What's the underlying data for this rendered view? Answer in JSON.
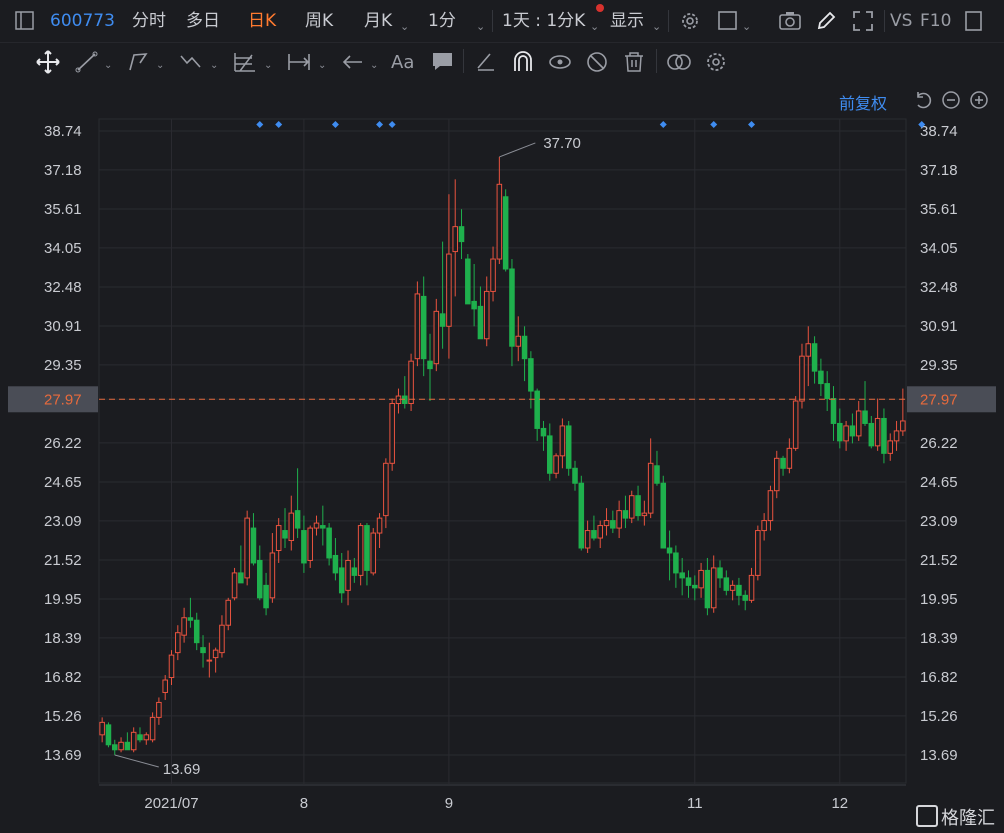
{
  "topbar": {
    "code": "600773",
    "tabs": [
      "分时",
      "多日",
      "日K",
      "周K",
      "月K",
      "1分"
    ],
    "active_tab": "日K",
    "period_select": "1天 : 1分K",
    "display_label": "显示",
    "vs_label": "VS",
    "f10_label": "F10"
  },
  "toolbar": {
    "icons": [
      "move-icon",
      "line-draw-icon",
      "polyline-icon",
      "wave-icon",
      "fib-grid-icon",
      "range-icon",
      "arrow-left-icon",
      "text-icon",
      "comment-icon",
      "eraser-icon",
      "magnet-icon",
      "eye-icon",
      "hide-icon",
      "trash-icon",
      "overlay-icon",
      "settings-icon"
    ],
    "text_glyph": "Aa"
  },
  "chart_ctrl": {
    "adjust_label": "前复权",
    "undo_icon": "undo-icon",
    "zoom_out_icon": "zoom-out-icon",
    "zoom_in_icon": "zoom-in-icon"
  },
  "watermark": "格隆汇",
  "chart_data": {
    "type": "candlestick",
    "y_ticks": [
      "38.74",
      "37.18",
      "35.61",
      "34.05",
      "32.48",
      "30.91",
      "29.35",
      "27.97",
      "26.22",
      "24.65",
      "23.09",
      "21.52",
      "19.95",
      "18.39",
      "16.82",
      "15.26",
      "13.69"
    ],
    "x_tick_labels": [
      {
        "label": "2021/07",
        "bar": 11
      },
      {
        "label": "8",
        "bar": 32
      },
      {
        "label": "9",
        "bar": 55
      },
      {
        "label": "11",
        "bar": 94
      },
      {
        "label": "12",
        "bar": 117
      }
    ],
    "ylim": [
      13.69,
      38.74
    ],
    "current_price": 27.97,
    "max_annotation": {
      "value": 37.7,
      "label": "37.70",
      "bar": 63
    },
    "min_annotation": {
      "value": 13.69,
      "label": "13.69",
      "bar": 2
    },
    "event_markers": [
      25,
      28,
      37,
      44,
      46,
      89,
      97,
      103,
      130
    ],
    "colors": {
      "up": "#e9533f",
      "down": "#1fb04d",
      "price_line": "#e86a3c",
      "price_tag_bg": "#4a4d56",
      "marker": "#3f8cf0"
    },
    "candles": [
      [
        14.5,
        15.2,
        14.2,
        15.0
      ],
      [
        14.9,
        15.0,
        14.0,
        14.1
      ],
      [
        14.1,
        14.3,
        13.69,
        13.9
      ],
      [
        13.9,
        14.4,
        13.8,
        14.2
      ],
      [
        14.2,
        14.6,
        13.9,
        13.9
      ],
      [
        13.9,
        14.8,
        13.8,
        14.6
      ],
      [
        14.5,
        14.8,
        14.2,
        14.3
      ],
      [
        14.3,
        14.6,
        14.1,
        14.5
      ],
      [
        14.3,
        15.4,
        14.2,
        15.2
      ],
      [
        15.2,
        16.0,
        14.9,
        15.8
      ],
      [
        16.2,
        16.9,
        15.9,
        16.7
      ],
      [
        16.8,
        17.9,
        16.5,
        17.7
      ],
      [
        17.8,
        18.9,
        17.5,
        18.6
      ],
      [
        18.5,
        19.6,
        18.2,
        19.2
      ],
      [
        19.2,
        20.0,
        18.8,
        19.1
      ],
      [
        19.1,
        19.4,
        17.9,
        18.2
      ],
      [
        18.0,
        18.5,
        17.2,
        17.8
      ],
      [
        17.5,
        18.2,
        16.8,
        17.5
      ],
      [
        17.6,
        18.0,
        17.0,
        17.9
      ],
      [
        17.8,
        19.3,
        17.6,
        18.9
      ],
      [
        18.9,
        20.0,
        18.7,
        19.9
      ],
      [
        20.0,
        21.2,
        19.9,
        21.0
      ],
      [
        21.0,
        22.1,
        20.7,
        20.6
      ],
      [
        20.8,
        23.5,
        20.5,
        23.2
      ],
      [
        22.8,
        23.4,
        21.3,
        21.4
      ],
      [
        21.5,
        22.1,
        19.9,
        20.0
      ],
      [
        20.5,
        21.0,
        19.3,
        19.6
      ],
      [
        20.0,
        22.6,
        19.8,
        21.8
      ],
      [
        21.9,
        23.2,
        21.4,
        22.9
      ],
      [
        22.7,
        23.6,
        22.0,
        22.4
      ],
      [
        22.3,
        24.1,
        21.9,
        23.4
      ],
      [
        23.5,
        25.2,
        22.4,
        22.8
      ],
      [
        22.7,
        23.3,
        21.0,
        21.4
      ],
      [
        21.5,
        22.9,
        21.2,
        22.8
      ],
      [
        22.8,
        23.3,
        22.5,
        23.0
      ],
      [
        22.9,
        23.7,
        22.1,
        22.8
      ],
      [
        22.8,
        23.0,
        21.3,
        21.6
      ],
      [
        21.7,
        22.4,
        20.7,
        21.0
      ],
      [
        21.2,
        21.8,
        19.8,
        20.2
      ],
      [
        20.3,
        21.9,
        19.7,
        21.5
      ],
      [
        21.2,
        21.6,
        20.6,
        20.9
      ],
      [
        20.9,
        23.0,
        20.5,
        22.9
      ],
      [
        22.9,
        23.0,
        20.5,
        21.1
      ],
      [
        21.0,
        22.8,
        20.9,
        22.6
      ],
      [
        22.6,
        23.4,
        22.0,
        23.2
      ],
      [
        23.3,
        25.6,
        22.8,
        25.4
      ],
      [
        25.4,
        28.0,
        25.1,
        27.8
      ],
      [
        27.8,
        28.4,
        27.4,
        28.1
      ],
      [
        28.1,
        28.9,
        27.6,
        27.8
      ],
      [
        27.8,
        29.8,
        27.5,
        29.5
      ],
      [
        29.6,
        32.7,
        29.3,
        32.2
      ],
      [
        32.1,
        32.9,
        28.9,
        29.6
      ],
      [
        29.5,
        30.6,
        27.9,
        29.2
      ],
      [
        29.4,
        32.0,
        29.1,
        31.5
      ],
      [
        31.4,
        34.3,
        30.0,
        30.9
      ],
      [
        30.9,
        36.2,
        29.6,
        33.8
      ],
      [
        33.9,
        36.8,
        32.1,
        34.9
      ],
      [
        34.9,
        35.6,
        33.6,
        34.3
      ],
      [
        33.6,
        33.8,
        31.9,
        31.8
      ],
      [
        31.9,
        33.4,
        30.9,
        31.6
      ],
      [
        31.7,
        32.5,
        30.4,
        30.4
      ],
      [
        30.4,
        32.9,
        30.1,
        32.3
      ],
      [
        32.3,
        34.1,
        31.9,
        33.6
      ],
      [
        33.6,
        37.7,
        33.4,
        36.6
      ],
      [
        36.1,
        36.4,
        33.1,
        33.2
      ],
      [
        33.2,
        33.6,
        29.3,
        30.1
      ],
      [
        30.1,
        31.3,
        29.5,
        30.5
      ],
      [
        30.5,
        30.9,
        28.7,
        29.6
      ],
      [
        29.6,
        29.9,
        27.6,
        28.3
      ],
      [
        28.3,
        28.4,
        26.3,
        26.8
      ],
      [
        26.8,
        27.1,
        25.9,
        26.5
      ],
      [
        26.5,
        27.0,
        24.7,
        25.0
      ],
      [
        25.0,
        25.8,
        24.8,
        25.7
      ],
      [
        25.7,
        27.2,
        25.2,
        26.9
      ],
      [
        26.9,
        27.1,
        24.9,
        25.2
      ],
      [
        25.2,
        25.5,
        24.3,
        24.6
      ],
      [
        24.6,
        24.9,
        21.9,
        22.0
      ],
      [
        22.0,
        23.1,
        21.8,
        22.7
      ],
      [
        22.7,
        23.3,
        22.3,
        22.4
      ],
      [
        22.4,
        23.1,
        22.0,
        22.9
      ],
      [
        22.9,
        23.6,
        22.5,
        23.1
      ],
      [
        23.1,
        23.5,
        22.6,
        22.8
      ],
      [
        22.8,
        23.9,
        22.4,
        23.5
      ],
      [
        23.5,
        24.1,
        22.8,
        23.2
      ],
      [
        23.2,
        24.3,
        23.0,
        24.1
      ],
      [
        24.1,
        24.5,
        23.1,
        23.3
      ],
      [
        23.3,
        23.9,
        22.9,
        23.4
      ],
      [
        23.4,
        26.4,
        23.2,
        25.4
      ],
      [
        25.3,
        25.9,
        24.5,
        24.6
      ],
      [
        24.6,
        24.9,
        22.1,
        22.0
      ],
      [
        22.0,
        22.7,
        20.7,
        21.8
      ],
      [
        21.8,
        22.1,
        20.4,
        21.0
      ],
      [
        21.0,
        21.6,
        20.1,
        20.8
      ],
      [
        20.8,
        21.1,
        20.0,
        20.5
      ],
      [
        20.5,
        20.9,
        19.9,
        20.4
      ],
      [
        20.4,
        21.4,
        20.0,
        21.1
      ],
      [
        21.1,
        21.6,
        19.3,
        19.6
      ],
      [
        19.6,
        21.7,
        19.4,
        21.2
      ],
      [
        21.2,
        21.5,
        20.4,
        20.8
      ],
      [
        20.8,
        21.1,
        20.1,
        20.3
      ],
      [
        20.3,
        20.7,
        19.9,
        20.5
      ],
      [
        20.5,
        20.8,
        19.7,
        20.1
      ],
      [
        20.1,
        20.3,
        19.5,
        19.9
      ],
      [
        19.9,
        21.2,
        19.8,
        20.9
      ],
      [
        20.9,
        22.9,
        20.7,
        22.7
      ],
      [
        22.7,
        23.4,
        22.3,
        23.1
      ],
      [
        23.1,
        24.5,
        22.7,
        24.3
      ],
      [
        24.3,
        25.9,
        24.0,
        25.6
      ],
      [
        25.6,
        25.7,
        24.9,
        25.2
      ],
      [
        25.2,
        26.4,
        25.0,
        26.0
      ],
      [
        26.0,
        28.1,
        25.9,
        27.9
      ],
      [
        27.9,
        30.2,
        27.6,
        29.7
      ],
      [
        29.7,
        30.9,
        28.5,
        30.2
      ],
      [
        30.2,
        30.5,
        28.6,
        29.1
      ],
      [
        29.1,
        29.6,
        28.1,
        28.6
      ],
      [
        28.6,
        29.1,
        27.5,
        28.0
      ],
      [
        28.0,
        28.5,
        26.3,
        27.0
      ],
      [
        27.0,
        27.6,
        26.0,
        26.3
      ],
      [
        26.3,
        27.1,
        25.9,
        26.9
      ],
      [
        26.9,
        27.4,
        26.2,
        26.5
      ],
      [
        26.5,
        27.9,
        26.3,
        27.5
      ],
      [
        27.5,
        28.7,
        26.9,
        27.0
      ],
      [
        27.0,
        27.3,
        26.0,
        26.1
      ],
      [
        26.1,
        28.0,
        25.9,
        27.2
      ],
      [
        27.2,
        27.6,
        25.4,
        25.8
      ],
      [
        25.8,
        26.6,
        25.5,
        26.3
      ],
      [
        26.3,
        27.1,
        25.9,
        26.7
      ],
      [
        26.7,
        28.4,
        26.5,
        27.1
      ]
    ]
  }
}
